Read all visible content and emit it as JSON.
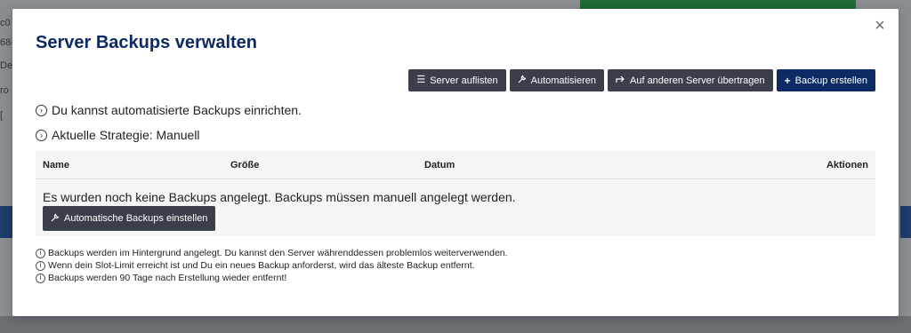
{
  "modal": {
    "title": "Server Backups verwalten",
    "close_glyph": "×"
  },
  "toolbar": {
    "list_servers": "Server auflisten",
    "automate": "Automatisieren",
    "transfer": "Auf anderen Server übertragen",
    "create_backup": "Backup erstellen"
  },
  "info": {
    "line1": "Du kannst automatisierte Backups einrichten.",
    "line2": "Aktuelle Strategie: Manuell"
  },
  "table": {
    "columns": [
      "Name",
      "Größe",
      "Datum",
      "Aktionen"
    ],
    "empty_message": "Es wurden noch keine Backups angelegt. Backups müssen manuell angelegt werden.",
    "auto_button": "Automatische Backups einstellen"
  },
  "notes": [
    "Backups werden im Hintergrund angelegt. Du kannst den Server währenddessen problemlos weiterverwenden.",
    "Wenn dein Slot-Limit erreicht ist und Du ein neues Backup anforderst, wird das älteste Backup entfernt.",
    "Backups werden 90 Tage nach Erstellung wieder entfernt!"
  ],
  "background": {
    "fragments": [
      "c0",
      "68-",
      "De",
      "ro",
      "[ "
    ]
  },
  "colors": {
    "primary": "#0c2a63",
    "secondary_button": "#3b3f4b",
    "overlay": "#8a8d92"
  },
  "icons": {
    "list": "list-icon",
    "wrench": "wrench-icon",
    "transfer": "share-icon",
    "plus": "plus-icon",
    "chevron_circle": "chevron-circle-right-icon",
    "info": "info-circle-icon",
    "close": "close-icon"
  }
}
